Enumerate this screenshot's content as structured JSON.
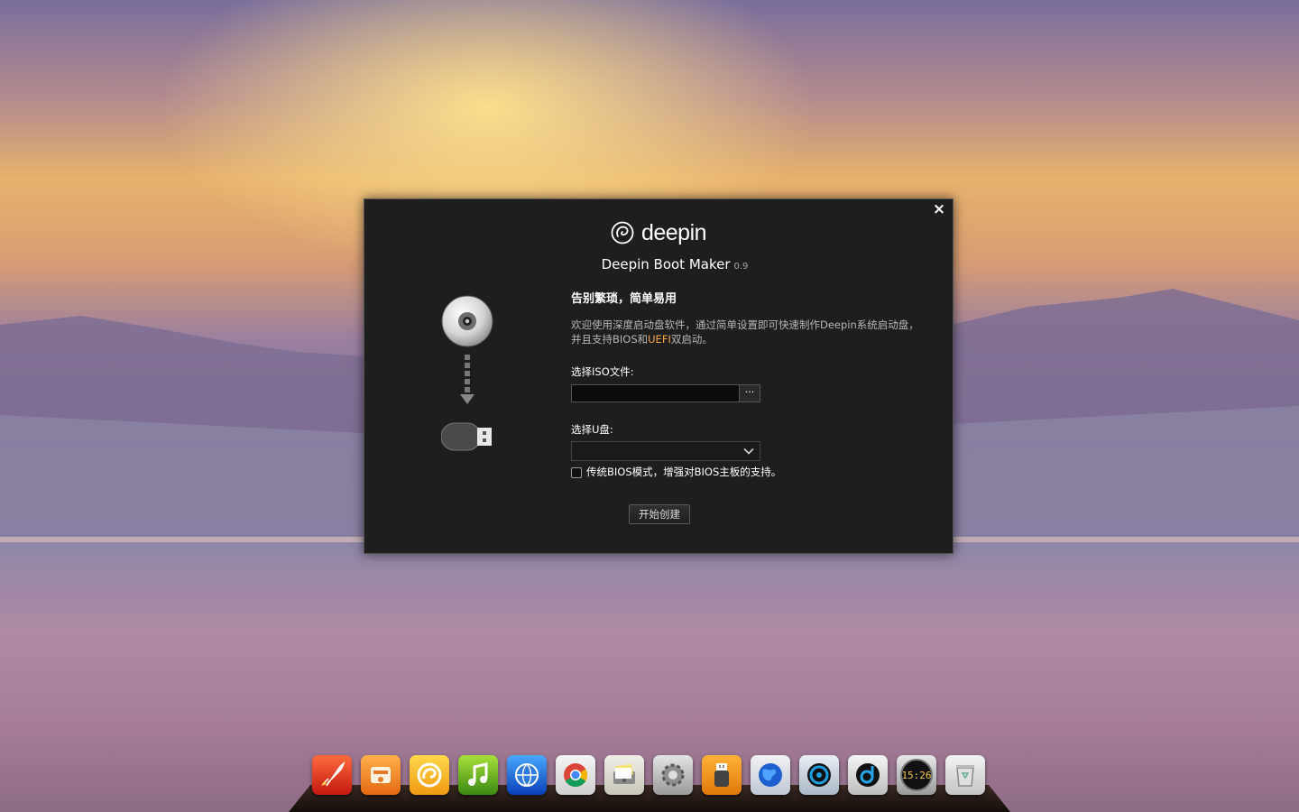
{
  "dialog": {
    "logo_text": "deepin",
    "app_title": "Deepin Boot Maker",
    "app_version": "0.9",
    "close_label": "×",
    "slogan": "告别繁琐，简单易用",
    "description_part1": "欢迎使用深度启动盘软件，通过简单设置即可快速制作Deepin系统启动盘，并且支持BIOS和",
    "description_highlight": "UEFI",
    "description_part2": "双启动。",
    "iso_label": "选择ISO文件:",
    "iso_value": "",
    "browse_label": "···",
    "usb_label": "选择U盘:",
    "usb_value": "",
    "bios_checkbox_checked": false,
    "bios_label": "传统BIOS模式，增强对BIOS主板的支持。",
    "start_button_label": "开始创建",
    "accent_color": "#ffa84a"
  },
  "dock": {
    "items": [
      {
        "name": "launcher-rocket-icon"
      },
      {
        "name": "software-center-icon"
      },
      {
        "name": "deepin-game-icon"
      },
      {
        "name": "deepin-music-icon"
      },
      {
        "name": "network-globe-icon"
      },
      {
        "name": "chrome-icon"
      },
      {
        "name": "file-manager-icon"
      },
      {
        "name": "settings-gear-icon"
      },
      {
        "name": "boot-maker-usb-icon"
      },
      {
        "name": "browser-globe-icon"
      },
      {
        "name": "deepin-movie-icon"
      },
      {
        "name": "deepin-player-icon"
      },
      {
        "name": "clock-icon",
        "time": "15:26"
      },
      {
        "name": "trash-icon"
      }
    ]
  }
}
